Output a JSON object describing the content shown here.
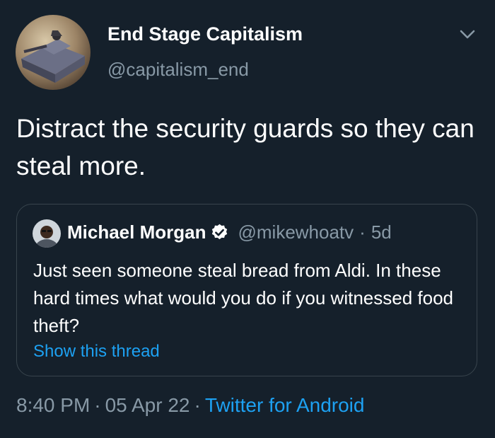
{
  "author": {
    "name": "End Stage Capitalism",
    "handle": "@capitalism_end"
  },
  "tweet": {
    "text": "Distract the security guards so they can steal more."
  },
  "quoted": {
    "name": "Michael Morgan",
    "handle": "@mikewhoatv",
    "dot": "·",
    "time": "5d",
    "text": "Just seen someone steal bread from Aldi. In these hard times what would you do if you witnessed food theft?",
    "show_thread": "Show this thread"
  },
  "footer": {
    "time": "8:40 PM",
    "sep1": "·",
    "date": "05 Apr 22",
    "sep2": "·",
    "source": "Twitter for Android"
  },
  "colors": {
    "background": "#15202b",
    "secondary_text": "#8899a6",
    "link": "#1da1f2",
    "border": "#38444d"
  },
  "icons": {
    "caret": "chevron-down-icon",
    "verified": "verified-badge-icon"
  }
}
